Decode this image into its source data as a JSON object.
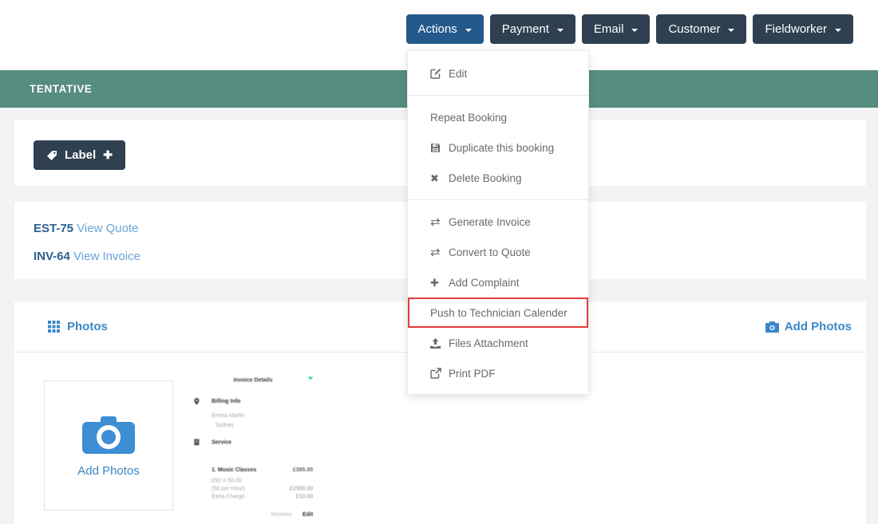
{
  "toolbar": {
    "buttons": [
      {
        "label": "Actions",
        "active": true
      },
      {
        "label": "Payment",
        "active": false
      },
      {
        "label": "Email",
        "active": false
      },
      {
        "label": "Customer",
        "active": false
      },
      {
        "label": "Fieldworker",
        "active": false
      }
    ]
  },
  "menu": {
    "items": [
      {
        "label": "Edit",
        "icon": "edit-icon"
      },
      {
        "label": "Repeat Booking",
        "icon": null
      },
      {
        "label": "Duplicate this booking",
        "icon": "save-icon"
      },
      {
        "label": "Delete Booking",
        "icon": "x-icon"
      },
      {
        "label": "Generate Invoice",
        "icon": "exchange-icon"
      },
      {
        "label": "Convert to Quote",
        "icon": "exchange-icon"
      },
      {
        "label": "Add Complaint",
        "icon": "plus-icon"
      },
      {
        "label": "Push to Technician Calender",
        "icon": null,
        "highlighted": true
      },
      {
        "label": "Files Attachment",
        "icon": "upload-icon"
      },
      {
        "label": "Print PDF",
        "icon": "external-link-icon"
      }
    ]
  },
  "icons": {
    "exchange": "⇄",
    "x": "✖",
    "plus": "✚",
    "label_plus": "✚"
  },
  "status_banner": {
    "label": "TENTATIVE"
  },
  "label_card": {
    "button_label": "Label"
  },
  "documents_card": {
    "quote_ref": "EST-75",
    "quote_link": "View Quote",
    "invoice_ref": "INV-64",
    "invoice_link": "View Invoice"
  },
  "photos_section": {
    "title": "Photos",
    "add_photos_label": "Add Photos",
    "tile_label": "Add Photos",
    "preview": {
      "title": "Invoice Details",
      "billing_heading": "Billing Info",
      "billing_name": "Emma Martin",
      "billing_city": "Sydney",
      "service_heading": "Service",
      "item_name": "1. Music Classes",
      "item_price": "£395.00",
      "line1_left": "£50 X 50.00",
      "line2_left": "(50 per Hour)",
      "line3_left": "Extra Charge",
      "line2_right": "£2500.00",
      "line3_right": "£10.00",
      "footer_remove": "Remove",
      "footer_edit": "Edit"
    }
  },
  "colors": {
    "dark_button": "#2f4050",
    "actions_button": "#24598c",
    "banner_teal": "#578c80",
    "highlight_red": "#e23b3b",
    "menu_text": "#676a6c",
    "link_dark": "#2b618f",
    "link_light": "#6aa3d8",
    "section_blue": "#3a87c8",
    "camera_blue": "#3d8ed2",
    "preview_caret_teal": "#23c6a4"
  }
}
